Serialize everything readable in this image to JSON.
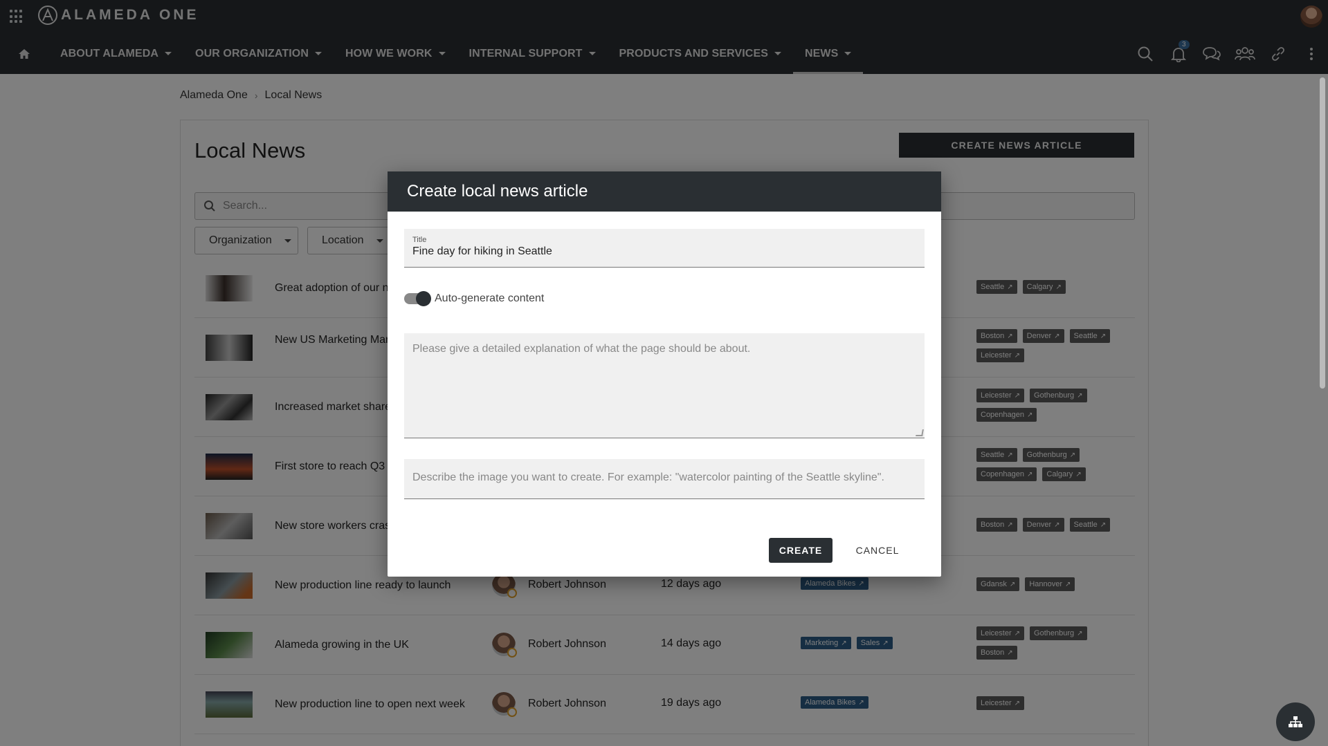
{
  "app": {
    "logo_text": "ALAMEDA ONE",
    "notification_count": "3"
  },
  "nav": {
    "items": [
      {
        "label": "ABOUT ALAMEDA"
      },
      {
        "label": "OUR ORGANIZATION"
      },
      {
        "label": "HOW WE WORK"
      },
      {
        "label": "INTERNAL SUPPORT"
      },
      {
        "label": "PRODUCTS AND SERVICES"
      },
      {
        "label": "NEWS"
      }
    ]
  },
  "breadcrumb": {
    "root": "Alameda One",
    "separator": "›",
    "current": "Local News"
  },
  "page": {
    "title": "Local News",
    "create_button": "CREATE NEWS ARTICLE",
    "search_placeholder": "Search...",
    "filters": [
      "Organization",
      "Location"
    ]
  },
  "news": [
    {
      "title": "Great adoption of our n",
      "author": "",
      "date": "",
      "tags": [],
      "locations": [
        "Seattle",
        "Calgary"
      ]
    },
    {
      "title": "New US Marketing Mar October",
      "author": "",
      "date": "",
      "tags": [],
      "locations": [
        "Boston",
        "Denver",
        "Seattle",
        "Leicester"
      ]
    },
    {
      "title": "Increased market share",
      "author": "",
      "date": "",
      "tags": [],
      "locations": [
        "Leicester",
        "Gothenburg",
        "Copenhagen"
      ]
    },
    {
      "title": "First store to reach Q3",
      "author": "",
      "date": "",
      "tags": [],
      "locations": [
        "Seattle",
        "Gothenburg",
        "Copenhagen",
        "Calgary"
      ]
    },
    {
      "title": "New store workers cras",
      "author": "",
      "date": "",
      "tags": [],
      "locations": [
        "Boston",
        "Denver",
        "Seattle"
      ]
    },
    {
      "title": "New production line ready to launch",
      "author": "Robert Johnson",
      "date": "12 days ago",
      "tags": [
        "Alameda Bikes"
      ],
      "locations": [
        "Gdansk",
        "Hannover"
      ]
    },
    {
      "title": "Alameda growing in the UK",
      "author": "Robert Johnson",
      "date": "14 days ago",
      "tags": [
        "Marketing",
        "Sales"
      ],
      "locations": [
        "Leicester",
        "Gothenburg",
        "Boston"
      ]
    },
    {
      "title": "New production line to open next week",
      "author": "Robert Johnson",
      "date": "19 days ago",
      "tags": [
        "Alameda Bikes"
      ],
      "locations": [
        "Leicester"
      ]
    }
  ],
  "modal": {
    "title": "Create local news article",
    "title_label": "Title",
    "title_value": "Fine day for hiking in Seattle",
    "toggle_label": "Auto-generate content",
    "toggle_on": true,
    "content_placeholder": "Please give a detailed explanation of what the page should be about.",
    "image_placeholder": "Describe the image you want to create. For example:  \"watercolor painting of the Seattle skyline\".",
    "create_label": "CREATE",
    "cancel_label": "CANCEL"
  },
  "colors": {
    "header_bg": "#2a2f33",
    "tag_blue": "#2c5d87",
    "location_gray": "#5a5a5a"
  }
}
